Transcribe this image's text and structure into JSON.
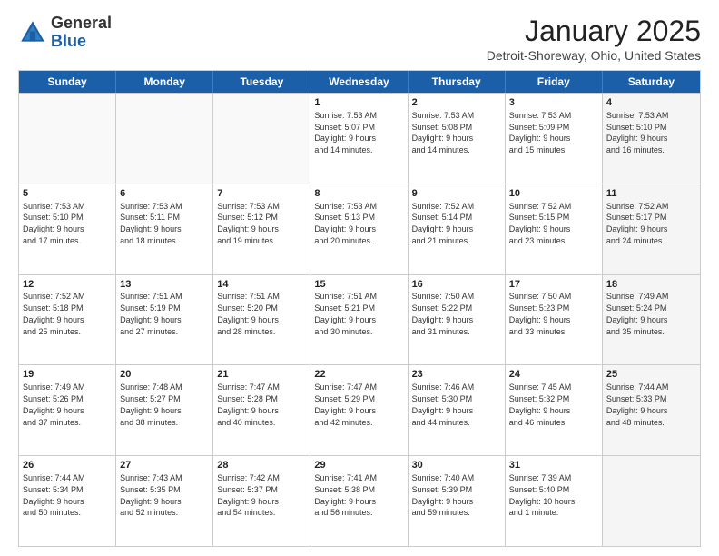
{
  "logo": {
    "general": "General",
    "blue": "Blue"
  },
  "title": "January 2025",
  "location": "Detroit-Shoreway, Ohio, United States",
  "weekdays": [
    "Sunday",
    "Monday",
    "Tuesday",
    "Wednesday",
    "Thursday",
    "Friday",
    "Saturday"
  ],
  "rows": [
    [
      {
        "day": "",
        "text": "",
        "empty": true
      },
      {
        "day": "",
        "text": "",
        "empty": true
      },
      {
        "day": "",
        "text": "",
        "empty": true
      },
      {
        "day": "1",
        "text": "Sunrise: 7:53 AM\nSunset: 5:07 PM\nDaylight: 9 hours\nand 14 minutes."
      },
      {
        "day": "2",
        "text": "Sunrise: 7:53 AM\nSunset: 5:08 PM\nDaylight: 9 hours\nand 14 minutes."
      },
      {
        "day": "3",
        "text": "Sunrise: 7:53 AM\nSunset: 5:09 PM\nDaylight: 9 hours\nand 15 minutes."
      },
      {
        "day": "4",
        "text": "Sunrise: 7:53 AM\nSunset: 5:10 PM\nDaylight: 9 hours\nand 16 minutes.",
        "shaded": true
      }
    ],
    [
      {
        "day": "5",
        "text": "Sunrise: 7:53 AM\nSunset: 5:10 PM\nDaylight: 9 hours\nand 17 minutes."
      },
      {
        "day": "6",
        "text": "Sunrise: 7:53 AM\nSunset: 5:11 PM\nDaylight: 9 hours\nand 18 minutes."
      },
      {
        "day": "7",
        "text": "Sunrise: 7:53 AM\nSunset: 5:12 PM\nDaylight: 9 hours\nand 19 minutes."
      },
      {
        "day": "8",
        "text": "Sunrise: 7:53 AM\nSunset: 5:13 PM\nDaylight: 9 hours\nand 20 minutes."
      },
      {
        "day": "9",
        "text": "Sunrise: 7:52 AM\nSunset: 5:14 PM\nDaylight: 9 hours\nand 21 minutes."
      },
      {
        "day": "10",
        "text": "Sunrise: 7:52 AM\nSunset: 5:15 PM\nDaylight: 9 hours\nand 23 minutes."
      },
      {
        "day": "11",
        "text": "Sunrise: 7:52 AM\nSunset: 5:17 PM\nDaylight: 9 hours\nand 24 minutes.",
        "shaded": true
      }
    ],
    [
      {
        "day": "12",
        "text": "Sunrise: 7:52 AM\nSunset: 5:18 PM\nDaylight: 9 hours\nand 25 minutes."
      },
      {
        "day": "13",
        "text": "Sunrise: 7:51 AM\nSunset: 5:19 PM\nDaylight: 9 hours\nand 27 minutes."
      },
      {
        "day": "14",
        "text": "Sunrise: 7:51 AM\nSunset: 5:20 PM\nDaylight: 9 hours\nand 28 minutes."
      },
      {
        "day": "15",
        "text": "Sunrise: 7:51 AM\nSunset: 5:21 PM\nDaylight: 9 hours\nand 30 minutes."
      },
      {
        "day": "16",
        "text": "Sunrise: 7:50 AM\nSunset: 5:22 PM\nDaylight: 9 hours\nand 31 minutes."
      },
      {
        "day": "17",
        "text": "Sunrise: 7:50 AM\nSunset: 5:23 PM\nDaylight: 9 hours\nand 33 minutes."
      },
      {
        "day": "18",
        "text": "Sunrise: 7:49 AM\nSunset: 5:24 PM\nDaylight: 9 hours\nand 35 minutes.",
        "shaded": true
      }
    ],
    [
      {
        "day": "19",
        "text": "Sunrise: 7:49 AM\nSunset: 5:26 PM\nDaylight: 9 hours\nand 37 minutes."
      },
      {
        "day": "20",
        "text": "Sunrise: 7:48 AM\nSunset: 5:27 PM\nDaylight: 9 hours\nand 38 minutes."
      },
      {
        "day": "21",
        "text": "Sunrise: 7:47 AM\nSunset: 5:28 PM\nDaylight: 9 hours\nand 40 minutes."
      },
      {
        "day": "22",
        "text": "Sunrise: 7:47 AM\nSunset: 5:29 PM\nDaylight: 9 hours\nand 42 minutes."
      },
      {
        "day": "23",
        "text": "Sunrise: 7:46 AM\nSunset: 5:30 PM\nDaylight: 9 hours\nand 44 minutes."
      },
      {
        "day": "24",
        "text": "Sunrise: 7:45 AM\nSunset: 5:32 PM\nDaylight: 9 hours\nand 46 minutes."
      },
      {
        "day": "25",
        "text": "Sunrise: 7:44 AM\nSunset: 5:33 PM\nDaylight: 9 hours\nand 48 minutes.",
        "shaded": true
      }
    ],
    [
      {
        "day": "26",
        "text": "Sunrise: 7:44 AM\nSunset: 5:34 PM\nDaylight: 9 hours\nand 50 minutes."
      },
      {
        "day": "27",
        "text": "Sunrise: 7:43 AM\nSunset: 5:35 PM\nDaylight: 9 hours\nand 52 minutes."
      },
      {
        "day": "28",
        "text": "Sunrise: 7:42 AM\nSunset: 5:37 PM\nDaylight: 9 hours\nand 54 minutes."
      },
      {
        "day": "29",
        "text": "Sunrise: 7:41 AM\nSunset: 5:38 PM\nDaylight: 9 hours\nand 56 minutes."
      },
      {
        "day": "30",
        "text": "Sunrise: 7:40 AM\nSunset: 5:39 PM\nDaylight: 9 hours\nand 59 minutes."
      },
      {
        "day": "31",
        "text": "Sunrise: 7:39 AM\nSunset: 5:40 PM\nDaylight: 10 hours\nand 1 minute."
      },
      {
        "day": "",
        "text": "",
        "empty": true,
        "shaded": true
      }
    ]
  ]
}
